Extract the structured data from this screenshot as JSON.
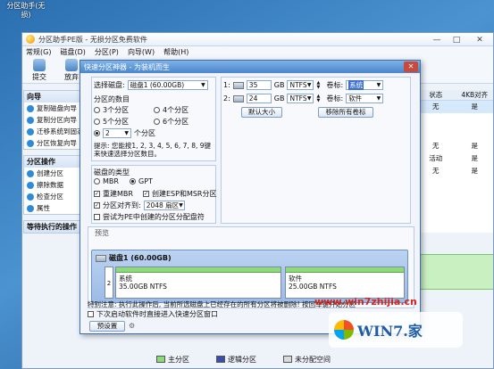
{
  "desktop": {
    "icon_label": "分区助手(无损)"
  },
  "app": {
    "title": "分区助手PE版 - 无损分区免费软件",
    "menu": [
      "常规(G)",
      "磁盘(D)",
      "分区(P)",
      "向导(W)",
      "帮助(H)"
    ],
    "toolbar": [
      "提交",
      "放弃"
    ],
    "side": {
      "wizard_head": "向导",
      "wizard_items": [
        "复制磁盘向导",
        "复制分区向导",
        "迁移系统到固态",
        "分区恢复向导"
      ],
      "ops_head": "分区操作",
      "ops_items": [
        "创建分区",
        "擦除数据",
        "检查分区",
        "属性"
      ],
      "pending_head": "等待执行的操作"
    },
    "rlist": {
      "headers": [
        "状态",
        "4KB对齐"
      ],
      "rows": [
        [
          "无",
          "是"
        ],
        [
          "无",
          "是"
        ],
        [
          "活动",
          "是"
        ],
        [
          "无",
          "是"
        ]
      ]
    },
    "legend": [
      "主分区",
      "逻辑分区",
      "未分配空间"
    ],
    "win_buttons": [
      "—",
      "□",
      "✕"
    ]
  },
  "dialog": {
    "title": "快速分区神器 - 为装机而生",
    "close": "✕",
    "disk_label": "选择磁盘:",
    "disk_value": "磁盘1 (60.00GB)",
    "count_label": "分区的数目",
    "count_options": [
      "3个分区",
      "4个分区",
      "5个分区",
      "6个分区"
    ],
    "custom_value": "2",
    "custom_suffix": "个分区",
    "tip": "提示: 您能按1, 2, 3, 4, 5, 6, 7, 8, 9键来快速选择分区数目。",
    "type_label": "磁盘的类型",
    "type_mbr": "MBR",
    "type_gpt": "GPT",
    "rebuild_mbr": "重建MBR",
    "create_esp": "创建ESP和MSR分区",
    "align_label": "分区对齐到:",
    "align_value": "2048 扇区",
    "try_pe": "尝试为PE中创建的分区分配盘符",
    "parts": [
      {
        "idx": "1:",
        "size": "35",
        "unit": "GB",
        "fs": "NTFS",
        "vol_label": "卷标:",
        "vol": "系统"
      },
      {
        "idx": "2:",
        "size": "24",
        "unit": "GB",
        "fs": "NTFS",
        "vol_label": "卷标:",
        "vol": "软件"
      }
    ],
    "default_size_btn": "默认大小",
    "remove_labels_btn": "移除所有卷标",
    "preview_label": "预览",
    "disk_bar_title": "磁盘1 (60.00GB)",
    "disk_bar_index": "2",
    "preview_parts": [
      {
        "name": "系统",
        "detail": "35.00GB NTFS"
      },
      {
        "name": "软件",
        "detail": "25.00GB NTFS"
      }
    ],
    "warning": "特别注意: 执行此操作后, 当前所选磁盘上已经存在的所有分区将被删除! 按回车键开始分区",
    "boot_option": "下次启动软件时直接进入快速分区窗口",
    "preset_btn": "预设置"
  },
  "watermark": {
    "url": "www.win7zhijia.cn",
    "logo_text": "WIN7.家"
  }
}
